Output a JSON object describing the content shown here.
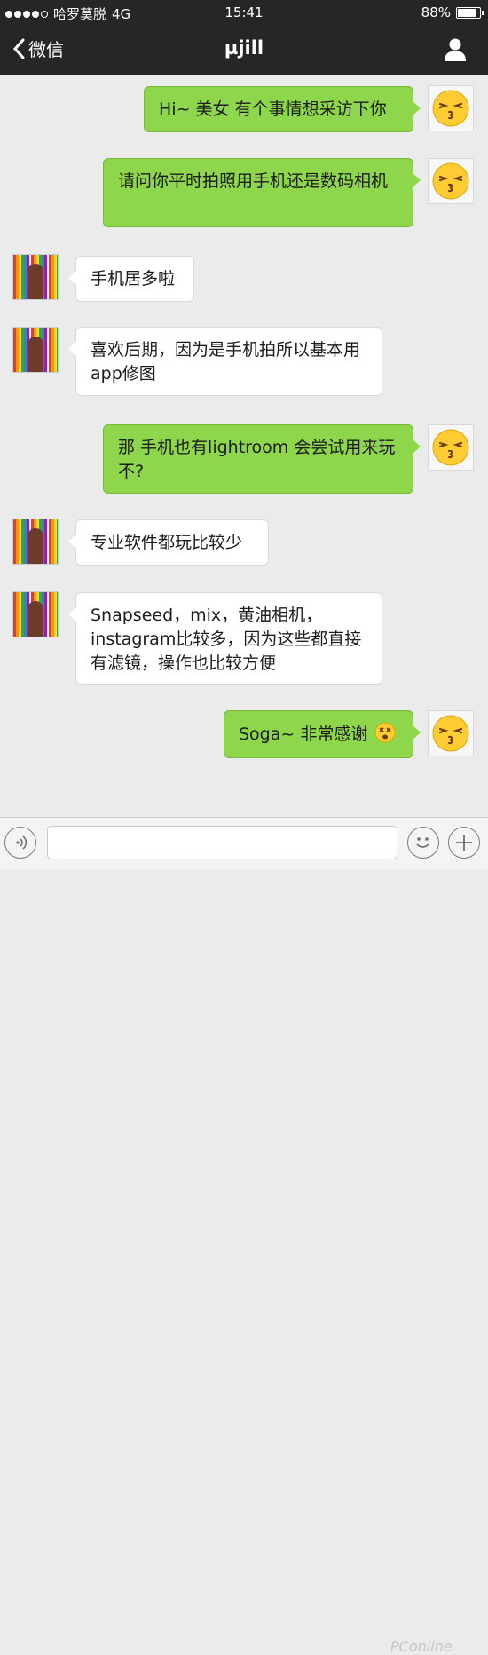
{
  "status_bar": {
    "carrier": "哈罗莫脱",
    "network": "4G",
    "time": "15:41",
    "battery": "88%",
    "battery_level": 0.88,
    "signal_bars": 4
  },
  "nav": {
    "back_label": "微信",
    "title": "µjill"
  },
  "messages": [
    {
      "side": "sent",
      "text": "Hi~ 美女 有个事情想采访下你"
    },
    {
      "side": "sent",
      "text": "请问你平时拍照用手机还是数码相机"
    },
    {
      "side": "recv",
      "text": "手机居多啦"
    },
    {
      "side": "recv",
      "text": "喜欢后期，因为是手机拍所以基本用app修图"
    },
    {
      "side": "sent",
      "text": "那 手机也有lightroom 会尝试用来玩不?"
    },
    {
      "side": "recv",
      "text": "专业软件都玩比较少"
    },
    {
      "side": "recv",
      "text": "Snapseed，mix，黄油相机，instagram比较多，因为这些都直接有滤镜，操作也比较方便"
    },
    {
      "side": "sent",
      "text": "Soga~ 非常感谢"
    }
  ],
  "input": {
    "placeholder": ""
  },
  "watermark": "PConline",
  "colors": {
    "bar_bg": "#262628",
    "chat_bg": "#ebebeb",
    "sent_bubble": "#8ed64b",
    "recv_bubble": "#ffffff"
  }
}
